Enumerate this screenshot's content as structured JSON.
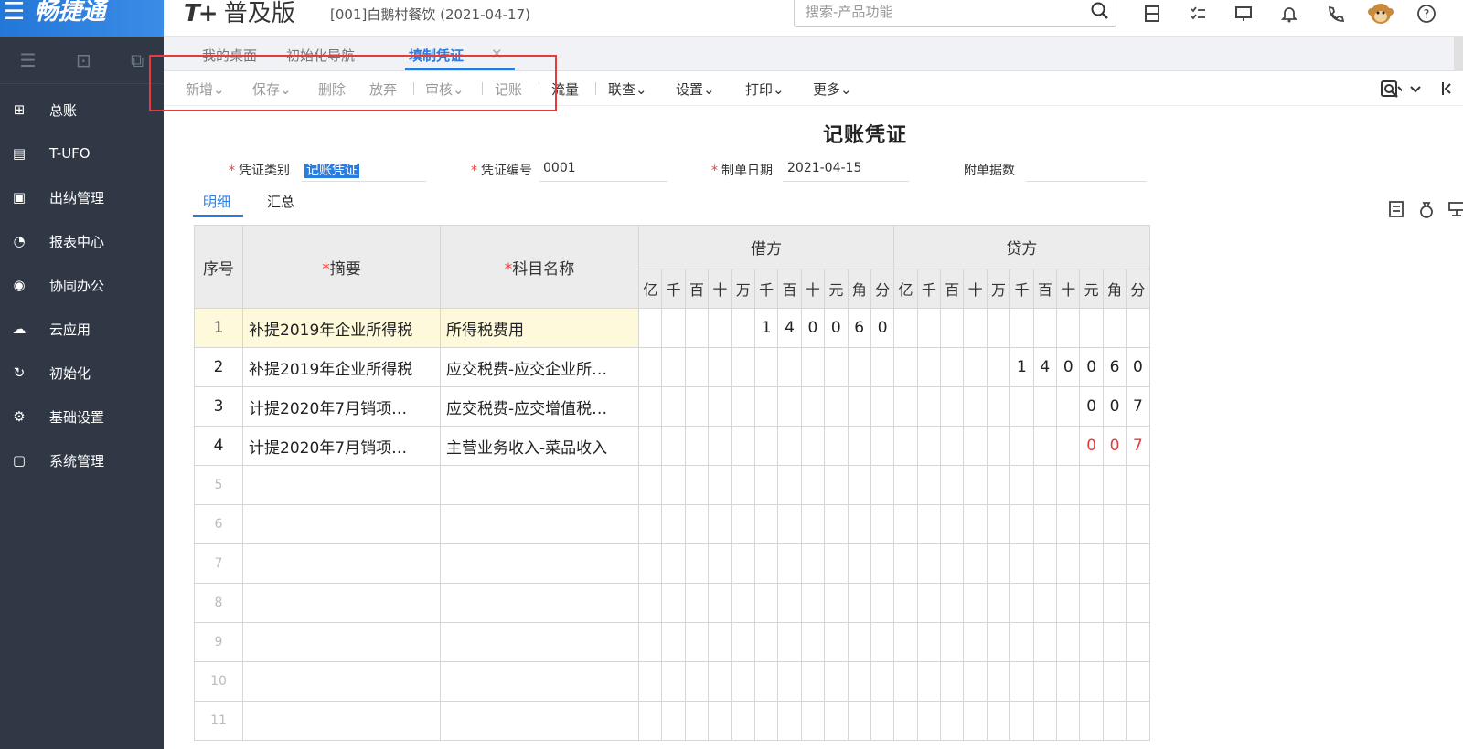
{
  "sidebar": {
    "logo": "畅捷通",
    "items": [
      {
        "label": "总账",
        "icon": "ledger-icon"
      },
      {
        "label": "T-UFO",
        "icon": "ufo-icon"
      },
      {
        "label": "出纳管理",
        "icon": "cashier-icon"
      },
      {
        "label": "报表中心",
        "icon": "report-icon"
      },
      {
        "label": "协同办公",
        "icon": "collab-icon"
      },
      {
        "label": "云应用",
        "icon": "cloud-icon"
      },
      {
        "label": "初始化",
        "icon": "init-icon"
      },
      {
        "label": "基础设置",
        "icon": "settings-icon"
      },
      {
        "label": "系统管理",
        "icon": "system-icon"
      }
    ]
  },
  "header": {
    "brand_mark": "T+",
    "brand": "普及版",
    "account": "[001]白鹅村餐饮  (2021-04-17)",
    "search_placeholder": "搜索-产品功能"
  },
  "tabs": {
    "home": "我的桌面",
    "init_nav": "初始化导航",
    "voucher": "填制凭证",
    "close": "✕"
  },
  "toolbar": {
    "add": "新增",
    "save": "保存",
    "delete": "删除",
    "discard": "放弃",
    "audit": "审核",
    "post": "记账",
    "flow": "流量",
    "query": "联查",
    "settings": "设置",
    "print": "打印",
    "more": "更多",
    "caret": "⌄"
  },
  "voucher": {
    "title": "记账凭证",
    "type_label": "凭证类别",
    "type_value": "记账凭证",
    "number_label": "凭证编号",
    "number_value": "0001",
    "date_label": "制单日期",
    "date_value": "2021-04-15",
    "attach_label": "附单据数",
    "attach_value": ""
  },
  "subtabs": {
    "detail": "明细",
    "summary": "汇总"
  },
  "table": {
    "h_no": "序号",
    "h_summary": "摘要",
    "h_account": "科目名称",
    "h_debit": "借方",
    "h_credit": "贷方",
    "req": "*",
    "digits": [
      "亿",
      "千",
      "百",
      "十",
      "万",
      "千",
      "百",
      "十",
      "元",
      "角",
      "分"
    ],
    "rows": [
      {
        "no": "1",
        "summary": "补提2019年企业所得税",
        "account": "所得税费用",
        "debit": [
          "",
          "",
          "",
          "",
          "",
          "1",
          "4",
          "0",
          "0",
          "6",
          "0"
        ],
        "credit": [
          "",
          "",
          "",
          "",
          "",
          "",
          "",
          "",
          "",
          "",
          ""
        ],
        "red": false
      },
      {
        "no": "2",
        "summary": "补提2019年企业所得税",
        "account": "应交税费-应交企业所…",
        "debit": [
          "",
          "",
          "",
          "",
          "",
          "",
          "",
          "",
          "",
          "",
          ""
        ],
        "credit": [
          "",
          "",
          "",
          "",
          "",
          "1",
          "4",
          "0",
          "0",
          "6",
          "0"
        ],
        "red": false
      },
      {
        "no": "3",
        "summary": "计提2020年7月销项…",
        "account": "应交税费-应交增值税…",
        "debit": [
          "",
          "",
          "",
          "",
          "",
          "",
          "",
          "",
          "",
          "",
          ""
        ],
        "credit": [
          "",
          "",
          "",
          "",
          "",
          "",
          "",
          "",
          "0",
          "0",
          "7"
        ],
        "red": false
      },
      {
        "no": "4",
        "summary": "计提2020年7月销项…",
        "account": "主营业务收入-菜品收入",
        "debit": [
          "",
          "",
          "",
          "",
          "",
          "",
          "",
          "",
          "",
          "",
          ""
        ],
        "credit": [
          "",
          "",
          "",
          "",
          "",
          "",
          "",
          "",
          "0",
          "0",
          "7"
        ],
        "red": true
      }
    ],
    "empty_rows": [
      "5",
      "6",
      "7",
      "8",
      "9",
      "10",
      "11"
    ]
  }
}
